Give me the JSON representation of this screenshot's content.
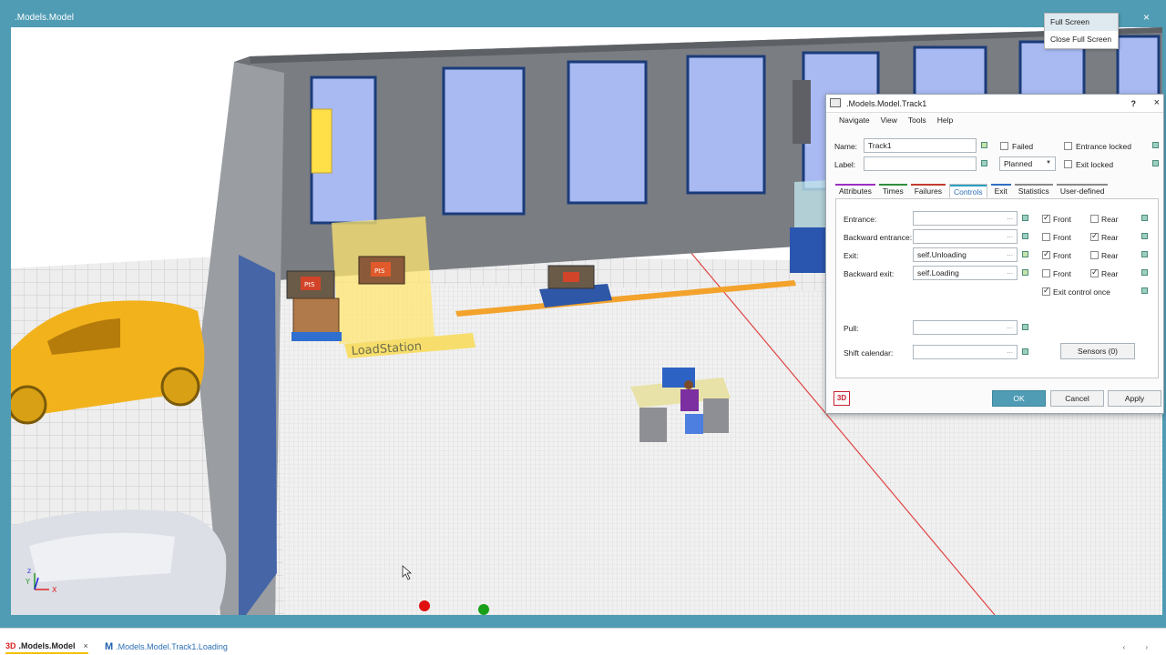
{
  "window": {
    "title": ".Models.Model",
    "close_glyph": "×"
  },
  "fullscreen_menu": {
    "items": [
      "Full Screen",
      "Close Full Screen"
    ]
  },
  "scene": {
    "station_label": "LoadStation",
    "crate_label": "PtS",
    "axis_y": "Y",
    "axis_x": "X",
    "axis_z": "Z"
  },
  "dialog": {
    "title": ".Models.Model.Track1",
    "help_glyph": "?",
    "close_glyph": "×",
    "menu": [
      "Navigate",
      "View",
      "Tools",
      "Help"
    ],
    "name_label": "Name:",
    "name_value": "Track1",
    "label_label": "Label:",
    "label_value": "",
    "failed_label": "Failed",
    "entrance_locked_label": "Entrance locked",
    "exit_locked_label": "Exit locked",
    "state_value": "Planned",
    "tabs": [
      {
        "label": "Attributes",
        "color": "#9b2fc2"
      },
      {
        "label": "Times",
        "color": "#2f8f3a"
      },
      {
        "label": "Failures",
        "color": "#c23a2f"
      },
      {
        "label": "Controls",
        "color": "#2b9fc0"
      },
      {
        "label": "Exit",
        "color": "#2f6fc0"
      },
      {
        "label": "Statistics",
        "color": "#8a8a8a"
      },
      {
        "label": "User-defined",
        "color": "#8a8a8a"
      }
    ],
    "controls": {
      "entrance_label": "Entrance:",
      "entrance_value": "",
      "backward_entrance_label": "Backward entrance:",
      "backward_entrance_value": "",
      "exit_label": "Exit:",
      "exit_value": "self.Unloading",
      "backward_exit_label": "Backward exit:",
      "backward_exit_value": "self.Loading",
      "pull_label": "Pull:",
      "pull_value": "",
      "shift_calendar_label": "Shift calendar:",
      "shift_calendar_value": "",
      "front_label": "Front",
      "rear_label": "Rear",
      "exit_control_once_label": "Exit control once",
      "sensors_label": "Sensors (0)",
      "dots": "..."
    },
    "badge": "3D",
    "ok_label": "OK",
    "cancel_label": "Cancel",
    "apply_label": "Apply"
  },
  "bottom_tabs": [
    {
      "prefix": "3D",
      "label": ".Models.Model",
      "close": "×"
    },
    {
      "prefix": "M",
      "label": ".Models.Model.Track1.Loading"
    }
  ],
  "scroll_arrows": "‹ ›"
}
